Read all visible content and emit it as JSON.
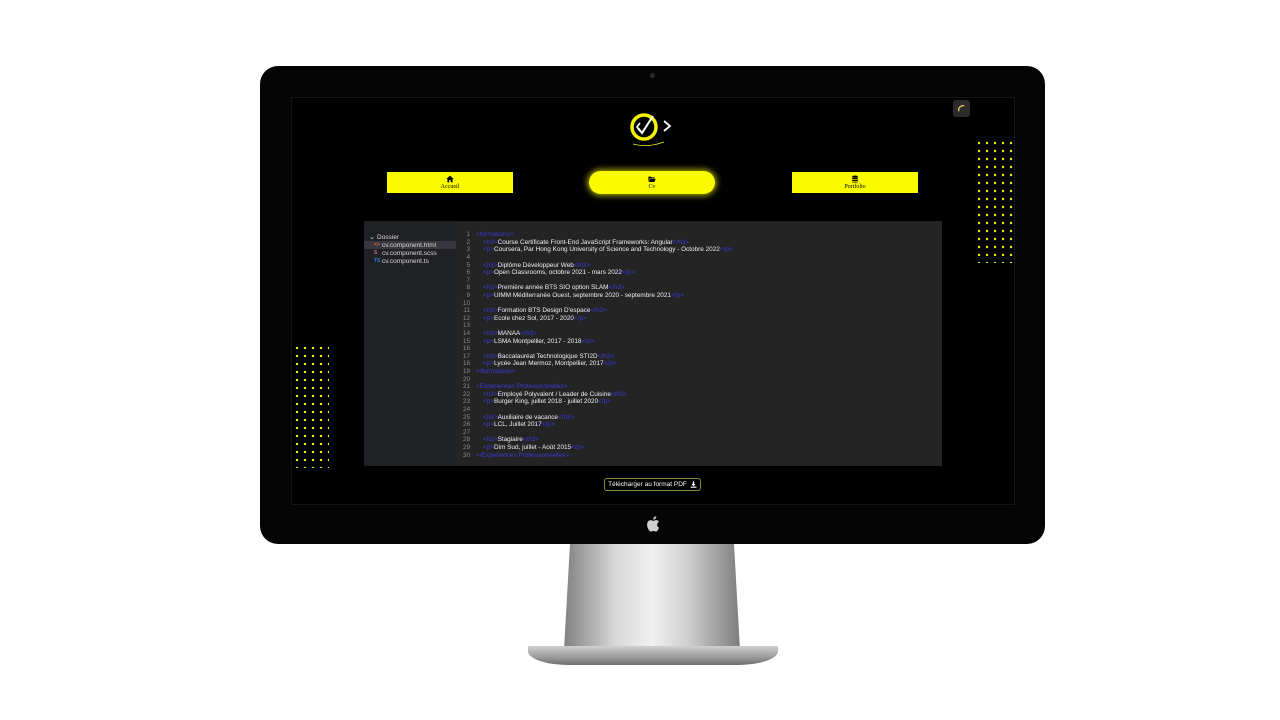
{
  "nav": {
    "home_label": "Accueil",
    "cv_label": "Cv",
    "portfolio_label": "Portfolio"
  },
  "explorer": {
    "folder_label": "Dossier",
    "files": [
      {
        "name": "cv.component.html",
        "icon": "html-file-icon",
        "badge": "<>",
        "color": "#e36b2c"
      },
      {
        "name": "cv.component.scss",
        "icon": "scss-file-icon",
        "badge": "S",
        "color": "#cf649a"
      },
      {
        "name": "cv.component.ts",
        "icon": "ts-file-icon",
        "badge": "TS",
        "color": "#3178c6"
      }
    ]
  },
  "code": {
    "lines": [
      {
        "n": "1",
        "indent": 0,
        "open": "<formations>",
        "text": "",
        "close": ""
      },
      {
        "n": "2",
        "indent": 1,
        "open": "<h3>",
        "text": "Course Certificate Front-End JavaScript Frameworks: Angular",
        "close": "</h3>"
      },
      {
        "n": "3",
        "indent": 1,
        "open": "<p>",
        "text": "Coursera, Par Hong Kong University of Science and Technology - Octobre 2022",
        "close": "</p>"
      },
      {
        "n": "4",
        "indent": 0,
        "open": "",
        "text": "",
        "close": ""
      },
      {
        "n": "5",
        "indent": 1,
        "open": "<h3>",
        "text": "Diplôme Développeur Web",
        "close": "</h3>"
      },
      {
        "n": "6",
        "indent": 1,
        "open": "<p>",
        "text": "Open Classrooms, octobre 2021 - mars 2022",
        "close": "</p>"
      },
      {
        "n": "7",
        "indent": 0,
        "open": "",
        "text": "",
        "close": ""
      },
      {
        "n": "8",
        "indent": 1,
        "open": "<h3>",
        "text": "Première année BTS SIO option SLAM",
        "close": "</h3>"
      },
      {
        "n": "9",
        "indent": 1,
        "open": "<p>",
        "text": "UIMM Méditerranée Ouest, septembre 2020 - septembre 2021",
        "close": "</p>"
      },
      {
        "n": "10",
        "indent": 0,
        "open": "",
        "text": "",
        "close": ""
      },
      {
        "n": "11",
        "indent": 1,
        "open": "<h3>",
        "text": "Formation BTS Design D'espace",
        "close": "</h3>"
      },
      {
        "n": "12",
        "indent": 1,
        "open": "<p>",
        "text": "Ecole chez Sol, 2017 - 2020",
        "close": "</p>"
      },
      {
        "n": "13",
        "indent": 0,
        "open": "",
        "text": "",
        "close": ""
      },
      {
        "n": "14",
        "indent": 1,
        "open": "<h3>",
        "text": "MANAA",
        "close": "</h3>"
      },
      {
        "n": "15",
        "indent": 1,
        "open": "<p>",
        "text": "LSMA Montpellier, 2017 - 2018",
        "close": "</p>"
      },
      {
        "n": "16",
        "indent": 0,
        "open": "",
        "text": "",
        "close": ""
      },
      {
        "n": "17",
        "indent": 1,
        "open": "<h3>",
        "text": "Baccalauréat Technologique STI2D",
        "close": "</h3>"
      },
      {
        "n": "18",
        "indent": 1,
        "open": "<p>",
        "text": "Lycée Jean Mermoz, Montpellier, 2017",
        "close": "</p>"
      },
      {
        "n": "19",
        "indent": 0,
        "open": "</formations>",
        "text": "",
        "close": ""
      },
      {
        "n": "20",
        "indent": 0,
        "open": "",
        "text": "",
        "close": ""
      },
      {
        "n": "21",
        "indent": 0,
        "open": "<Experiences Professionnelles>",
        "text": "",
        "close": ""
      },
      {
        "n": "22",
        "indent": 1,
        "open": "<h3>",
        "text": "Employé Polyvalent / Leader de Cuisine",
        "close": "</h3>"
      },
      {
        "n": "23",
        "indent": 1,
        "open": "<p>",
        "text": "Burger King, juillet 2018 - juillet 2020",
        "close": "</p>"
      },
      {
        "n": "24",
        "indent": 0,
        "open": "",
        "text": "",
        "close": ""
      },
      {
        "n": "25",
        "indent": 1,
        "open": "<h3>",
        "text": "Auxiliaire de vacance",
        "close": "</h3>"
      },
      {
        "n": "26",
        "indent": 1,
        "open": "<p>",
        "text": "LCL, Juillet 2017",
        "close": "</p>"
      },
      {
        "n": "27",
        "indent": 0,
        "open": "",
        "text": "",
        "close": ""
      },
      {
        "n": "28",
        "indent": 1,
        "open": "<h3>",
        "text": "Stagiaire",
        "close": "</h3>"
      },
      {
        "n": "29",
        "indent": 1,
        "open": "<p>",
        "text": "Dim Sud, juillet - Août 2015",
        "close": "</p>"
      },
      {
        "n": "30",
        "indent": 0,
        "open": "</Experiences Professionnelles>",
        "text": "",
        "close": ""
      }
    ]
  },
  "download": {
    "label": "Télécharger au format PDF"
  },
  "colors": {
    "accent": "#fbfb00",
    "tag": "#3b3bd6",
    "editor_bg": "#242424",
    "explorer_bg": "#202124"
  }
}
